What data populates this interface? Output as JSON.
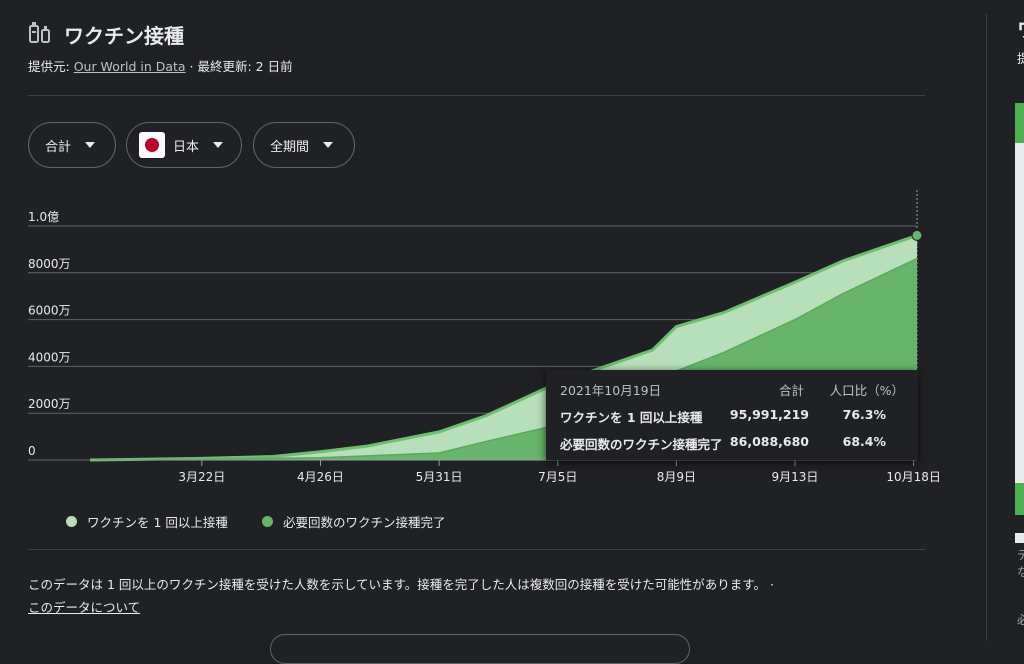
{
  "header": {
    "icon": "syringe-icon",
    "title": "ワクチン接種",
    "provider_label": "提供元: ",
    "provider_link": "Our World in Data",
    "updated": " · 最終更新: 2 日前"
  },
  "filters": [
    {
      "label": "合計"
    },
    {
      "label": "日本",
      "flag": "japan-flag-icon"
    },
    {
      "label": "全期間"
    }
  ],
  "chart_data": {
    "type": "area",
    "x_ticks": [
      "3月22日",
      "4月26日",
      "5月31日",
      "7月5日",
      "8月9日",
      "9月13日",
      "10月18日"
    ],
    "y_ticks": [
      "0",
      "2000万",
      "4000万",
      "6000万",
      "8000万",
      "1.0億"
    ],
    "ylim": [
      0,
      100000000
    ],
    "series": [
      {
        "name": "ワクチンを 1 回以上接種",
        "color": "#b7dfb9",
        "points": [
          [
            "2021-02-17",
            0
          ],
          [
            "2021-03-22",
            700000
          ],
          [
            "2021-04-12",
            1500000
          ],
          [
            "2021-04-26",
            3500000
          ],
          [
            "2021-05-10",
            6000000
          ],
          [
            "2021-05-31",
            12000000
          ],
          [
            "2021-06-14",
            19000000
          ],
          [
            "2021-07-05",
            33000000
          ],
          [
            "2021-07-19",
            40000000
          ],
          [
            "2021-08-02",
            47000000
          ],
          [
            "2021-08-09",
            57000000
          ],
          [
            "2021-08-23",
            63000000
          ],
          [
            "2021-09-13",
            76000000
          ],
          [
            "2021-09-27",
            85000000
          ],
          [
            "2021-10-19",
            95991219
          ]
        ]
      },
      {
        "name": "必要回数のワクチン接種完了",
        "color": "#66b56a",
        "points": [
          [
            "2021-02-17",
            0
          ],
          [
            "2021-03-22",
            300000
          ],
          [
            "2021-04-26",
            1000000
          ],
          [
            "2021-05-31",
            3000000
          ],
          [
            "2021-06-14",
            8000000
          ],
          [
            "2021-07-05",
            15000000
          ],
          [
            "2021-07-19",
            23000000
          ],
          [
            "2021-08-02",
            31000000
          ],
          [
            "2021-08-09",
            38000000
          ],
          [
            "2021-08-23",
            46000000
          ],
          [
            "2021-09-13",
            60000000
          ],
          [
            "2021-09-27",
            71000000
          ],
          [
            "2021-10-19",
            86088680
          ]
        ]
      }
    ]
  },
  "tooltip": {
    "date": "2021年10月19日",
    "col_total": "合計",
    "col_pct": "人口比（%）",
    "rows": [
      {
        "label": "ワクチンを 1 回以上接種",
        "total": "95,991,219",
        "pct": "76.3%"
      },
      {
        "label": "必要回数のワクチン接種完了",
        "total": "86,088,680",
        "pct": "68.4%"
      }
    ]
  },
  "legend": [
    {
      "label": "ワクチンを 1 回以上接種",
      "color": "#b7dfb9"
    },
    {
      "label": "必要回数のワクチン接種完了",
      "color": "#66b56a"
    }
  ],
  "footer": {
    "note": "このデータは 1 回以上のワクチン接種を受けた人数を示しています。接種を完了した人は複数回の接種を受けた可能性があります。 ·",
    "about_link": "このデータについて"
  },
  "right_panel": {
    "title": "ワ",
    "subtitle": "提",
    "text1": "デ",
    "text2": "な",
    "text3": "必"
  }
}
